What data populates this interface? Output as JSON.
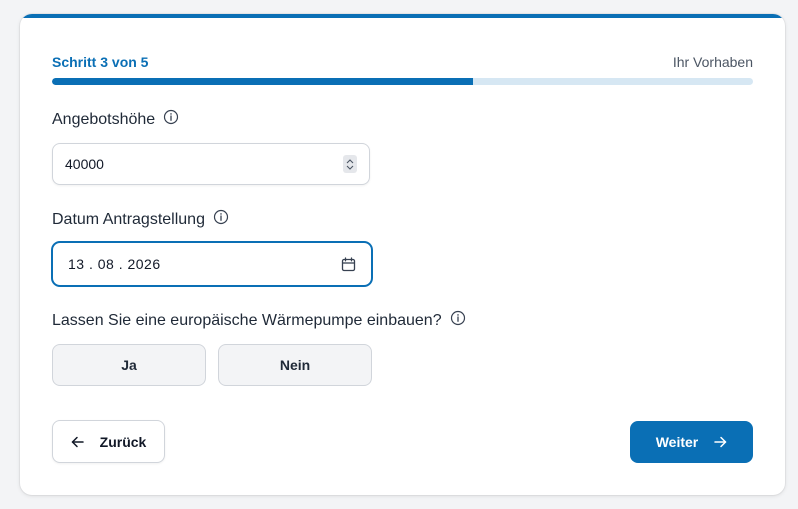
{
  "stepper": {
    "step_label": "Schritt 3 von 5",
    "section_title": "Ihr Vorhaben",
    "progress_fraction": 0.6
  },
  "fields": {
    "offer_amount": {
      "label": "Angebotshöhe",
      "value": "40000"
    },
    "application_date": {
      "label": "Datum Antragstellung",
      "value": "13 . 08 . 2026"
    },
    "heat_pump": {
      "question": "Lassen Sie eine europäische Wärmepumpe einbauen?",
      "options": [
        "Ja",
        "Nein"
      ]
    }
  },
  "navigation": {
    "back_label": "Zurück",
    "next_label": "Weiter"
  },
  "icons": {
    "info": "info-icon",
    "calendar": "calendar-icon",
    "stepper": "number-stepper-icon",
    "back": "arrow-left-icon",
    "next": "arrow-right-icon"
  },
  "colors": {
    "accent": "#0a6fb5",
    "progress_track": "#d6e7f3",
    "option_bg": "#f3f4f6"
  }
}
